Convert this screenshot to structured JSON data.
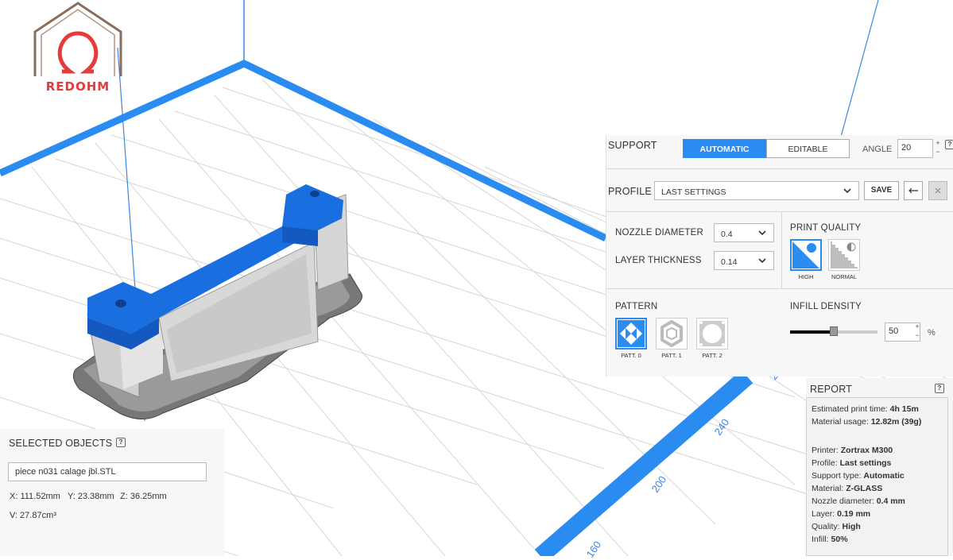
{
  "logo": {
    "text": "REDOHM"
  },
  "axis_labels": [
    "240",
    "200",
    "160",
    "2"
  ],
  "support": {
    "title": "SUPPORT",
    "automatic_label": "AUTOMATIC",
    "editable_label": "EDITABLE",
    "angle_label": "ANGLE",
    "angle_value": "20",
    "help": "?"
  },
  "profile": {
    "title": "PROFILE",
    "selected": "LAST SETTINGS",
    "save_label": "SAVE"
  },
  "settings": {
    "nozzle_label": "NOZZLE DIAMETER",
    "nozzle_value": "0.4",
    "layer_label": "LAYER THICKNESS",
    "layer_value": "0.14",
    "quality_title": "PRINT QUALITY",
    "quality_high": "HIGH",
    "quality_normal": "NORMAL",
    "pattern_title": "PATTERN",
    "patterns": [
      "PATT. 0",
      "PATT. 1",
      "PATT. 2"
    ],
    "infill_title": "INFILL DENSITY",
    "infill_value": "50",
    "infill_unit": "%",
    "infill_fraction": 0.5
  },
  "selected_objects": {
    "title": "SELECTED OBJECTS",
    "help": "?",
    "filename": "piece n031 calage jbl.STL",
    "x": "X: 111.52mm",
    "y": "Y: 23.38mm",
    "z": "Z: 36.25mm",
    "volume": "V: 27.87cm³"
  },
  "report": {
    "title": "REPORT",
    "help": "?",
    "lines": [
      {
        "label": "Estimated print time: ",
        "value": "4h 15m"
      },
      {
        "label": "Material usage: ",
        "value": "12.82m (39g)"
      },
      {
        "label": "Printer: ",
        "value": "Zortrax M300"
      },
      {
        "label": "Profile: ",
        "value": "Last settings"
      },
      {
        "label": "Support type: ",
        "value": "Automatic"
      },
      {
        "label": "Material: ",
        "value": "Z-GLASS"
      },
      {
        "label": "Nozzle diameter: ",
        "value": "0.4 mm"
      },
      {
        "label": "Layer: ",
        "value": "0.19 mm"
      },
      {
        "label": "Quality: ",
        "value": "High"
      },
      {
        "label": "Infill: ",
        "value": "50%"
      }
    ]
  },
  "colors": {
    "accent": "#2a8bf0",
    "model_blue": "#1a6fe0",
    "axis_blue": "#3d86e0",
    "logo_red": "#e53b3b"
  }
}
